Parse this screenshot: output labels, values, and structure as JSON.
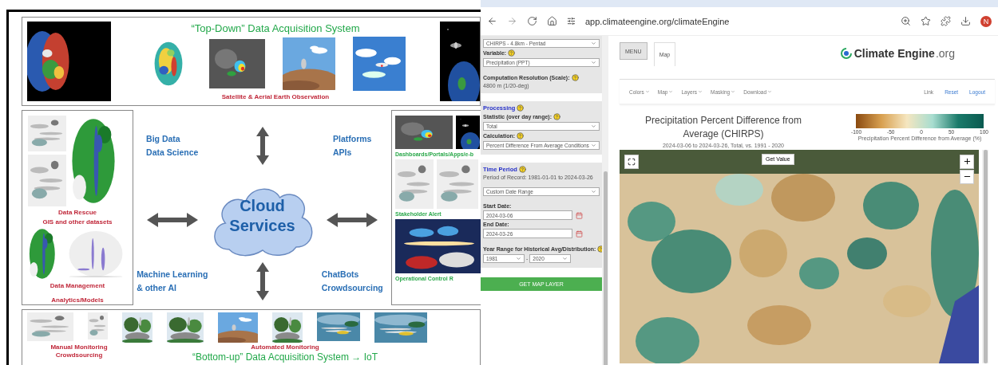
{
  "slide": {
    "top": {
      "title": "“Top-Down” Data Acquisition System",
      "caption": "Satellite & Aerial Earth Observation"
    },
    "left_box": {
      "captions": [
        "Data Rescue",
        "GIS and other datasets"
      ],
      "footer": [
        "Data Management",
        "Analytics/Models"
      ]
    },
    "center": {
      "top_left": [
        "Big Data",
        "Data Science"
      ],
      "top_right": [
        "Platforms",
        "APIs"
      ],
      "cloud": "Cloud Services",
      "bottom_left": [
        "Machine Learning",
        "& other AI"
      ],
      "bottom_right": [
        "ChatBots",
        "Crowdsourcing"
      ]
    },
    "right_box": {
      "captions": [
        "Dashboards/Portals/Apps/e-b",
        "Stakeholder Alert",
        "Operational Control R"
      ]
    },
    "bottom": {
      "manual": [
        "Manual Monitoring",
        "Crowdsourcing"
      ],
      "automated": "Automated Monitoring",
      "title": "“Bottom-up” Data Acquisition System → IoT"
    }
  },
  "browser": {
    "url": "app.climateengine.org/climateEngine",
    "avatar": "N"
  },
  "sidebar": {
    "sections": [
      {
        "rows": [
          {
            "kind": "select",
            "value": "CHIRPS - 4.8km - Pentad"
          },
          {
            "kind": "label",
            "text": "Variable:",
            "help": true
          },
          {
            "kind": "select",
            "value": "Precipitation (PPT)"
          },
          {
            "kind": "gap"
          },
          {
            "kind": "label",
            "text": "Computation Resolution (Scale):",
            "help": true
          },
          {
            "kind": "note",
            "text": "4800 m (1/20-deg)"
          }
        ]
      },
      {
        "rows": [
          {
            "kind": "heading",
            "text": "Processing",
            "help": true
          },
          {
            "kind": "label",
            "text": "Statistic (over day range):",
            "help": true
          },
          {
            "kind": "select",
            "value": "Total"
          },
          {
            "kind": "label",
            "text": "Calculation:",
            "help": true
          },
          {
            "kind": "select",
            "value": "Percent Difference From Average Conditions"
          }
        ]
      },
      {
        "rows": [
          {
            "kind": "heading",
            "text": "Time Period",
            "help": true
          },
          {
            "kind": "note",
            "text": "Period of Record: 1981-01-01 to 2024-03-26"
          },
          {
            "kind": "gap"
          },
          {
            "kind": "select",
            "value": "Custom Date Range"
          },
          {
            "kind": "gap"
          },
          {
            "kind": "label",
            "text": "Start Date:",
            "help": false
          },
          {
            "kind": "date",
            "value": "2024-03-06"
          },
          {
            "kind": "label",
            "text": "End Date:",
            "help": false
          },
          {
            "kind": "date",
            "value": "2024-03-26"
          },
          {
            "kind": "gap"
          },
          {
            "kind": "label",
            "text": "Year Range for Historical Avg/Distribution:",
            "help": true
          },
          {
            "kind": "years",
            "from": "1981",
            "separator": "-",
            "to": "2020"
          }
        ]
      }
    ],
    "button": "GET MAP LAYER"
  },
  "main": {
    "tabs": [
      {
        "label": "MENU",
        "selected": false
      },
      {
        "label": "Map",
        "selected": true
      }
    ],
    "logo": {
      "name": "Climate Engine",
      "domain": ".org"
    },
    "menus": [
      "Colors",
      "Map",
      "Layers",
      "Masking",
      "Download"
    ],
    "links": [
      {
        "label": "Link",
        "kind": "plain"
      },
      {
        "label": "Reset",
        "kind": "link"
      },
      {
        "label": "Logout",
        "kind": "link"
      }
    ],
    "title": "Precipitation Percent Difference from Average (CHIRPS)",
    "subtitle": "2024-03-06 to 2024-03-26, Total, vs. 1991 - 2020",
    "legend": {
      "ticks": [
        "-100",
        "-50",
        "0",
        "50",
        "100"
      ],
      "label": "Precipitation Percent Difference from Average (%)"
    },
    "map": {
      "get_value": "Get Value"
    }
  }
}
